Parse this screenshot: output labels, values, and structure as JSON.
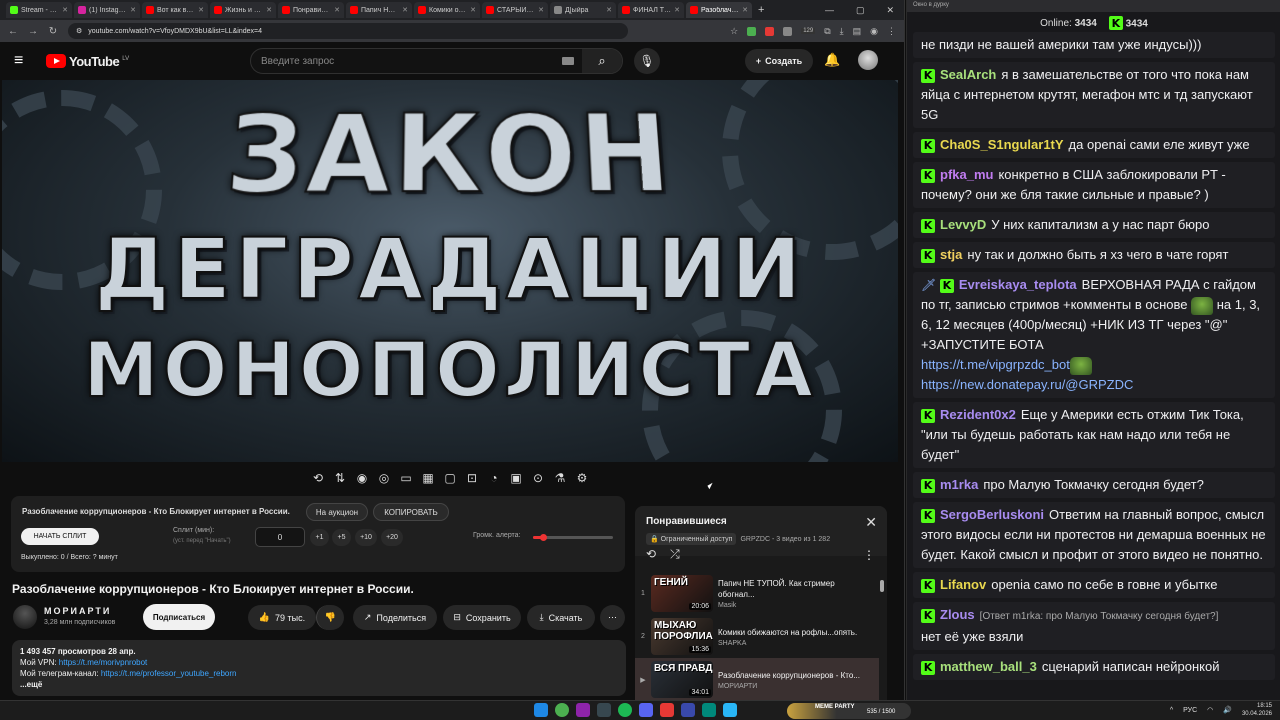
{
  "browser": {
    "tabs": [
      {
        "label": "Stream - Kick",
        "color": "#53fc18",
        "active": false
      },
      {
        "label": "(1) Instagram",
        "color": "#d6249f",
        "active": false
      },
      {
        "label": "Вот как в РФ",
        "color": "#ff0000",
        "active": false
      },
      {
        "label": "Жизнь и стр",
        "color": "#ff0000",
        "active": false
      },
      {
        "label": "Понравившиеся",
        "color": "#ff0000",
        "active": false
      },
      {
        "label": "Папич НЕ ТУП",
        "color": "#ff0000",
        "active": false
      },
      {
        "label": "Комики обиж",
        "color": "#ff0000",
        "active": false
      },
      {
        "label": "СТАРЫЙ БОГ",
        "color": "#ff0000",
        "active": false
      },
      {
        "label": "Д[ыйра",
        "color": "#888888",
        "active": false
      },
      {
        "label": "ФИНАЛ ТВИЧ",
        "color": "#ff0000",
        "active": false
      },
      {
        "label": "Разоблачени",
        "color": "#ff0000",
        "active": true
      }
    ],
    "url": "youtube.com/watch?v=VfoyDMDX9bU&list=LL&index=4",
    "ext_badge": "129"
  },
  "youtube": {
    "logo_text": "YouTube",
    "country": "LV",
    "search_placeholder": "Введите запрос",
    "create_label": "Создать"
  },
  "video": {
    "thumb_line1": "ЗАКОН",
    "thumb_line2": "ДЕГРАДАЦИИ",
    "thumb_line3": "МОНОПОЛИСТА"
  },
  "extension": {
    "title": "Разоблачение коррупционеров - Кто Блокирует интернет в России.",
    "auction_label": "На аукцион",
    "copy_label": "КОПИРОВАТЬ",
    "split_button": "НАЧАТЬ СПЛИТ",
    "split_label": "Сплит (мин):",
    "split_hint": "(уст. перед \"Начать\")",
    "split_value": "0",
    "inc": [
      "+1",
      "+5",
      "+10",
      "+20"
    ],
    "volume_label": "Громк. алерта:",
    "volume_level": 0.12,
    "status": "Выкуплено: 0 / Всего: ? минут"
  },
  "watch": {
    "title": "Разоблачение коррупционеров - Кто Блокирует интернет в России.",
    "channel": "МОРИАРТИ",
    "subs": "3,28 млн подписчиков",
    "subscribe": "Подписаться",
    "likes": "79 тыс.",
    "share": "Поделиться",
    "save": "Сохранить",
    "download": "Скачать",
    "views_line": "1 493 457 просмотров  28 апр.",
    "vpn_label": "Мой VPN: ",
    "vpn_link": "https://t.me/morivpnrobot",
    "tg_label": "Мой телеграм-канал: ",
    "tg_link": "https://t.me/professor_youtube_reborn",
    "more": "...ещё"
  },
  "playlist": {
    "title": "Понравившиеся",
    "access": "Ограниченный доступ",
    "meta": "GRPZDC - 3 видео из 1 282",
    "items": [
      {
        "n": "1",
        "title": "Папич НЕ ТУПОЙ. Как стример обогнал...",
        "channel": "Masik",
        "duration": "20:06",
        "thumb": "ГЕНИЙ",
        "bg": "#5a2a20"
      },
      {
        "n": "2",
        "title": "Комики обижаются на рофлы...опять.",
        "channel": "SHAPKA",
        "duration": "15:36",
        "thumb": "МЫХАЮ ПОРОФЛИА",
        "bg": "#4a3a30"
      },
      {
        "n": "▶",
        "title": "Разоблачение коррупционеров - Кто...",
        "channel": "МОРИАРТИ",
        "duration": "34:01",
        "thumb": "ВСЯ ПРАВД",
        "bg": "#2a3038"
      }
    ]
  },
  "chat": {
    "window_title": "Окно в дурку",
    "online_label": "Online:",
    "online": "3434",
    "viewers": "3434",
    "messages": [
      {
        "user": "",
        "color": "#efeff1",
        "text": "не пизди не вашей америки там уже индусы)))",
        "badge": false
      },
      {
        "user": "SealArch",
        "color": "#a8e07c",
        "text": "я в замешательстве от того что пока нам яйца с интернетом крутят, мегафон мтс и тд запускают 5G",
        "badge": true
      },
      {
        "user": "Cha0S_S1ngular1tY",
        "color": "#e9d84f",
        "text": "да openai сами еле живут уже",
        "badge": true
      },
      {
        "user": "pfka_mu",
        "color": "#c07cf0",
        "text": "конкретно в США заблокировали PT - почему? они же бля такие сильные и правые? )",
        "badge": true
      },
      {
        "user": "LevvyD",
        "color": "#a8e07c",
        "text": "У них капитализм а у нас парт бюро",
        "badge": true
      },
      {
        "user": "stja",
        "color": "#f0d060",
        "text": "ну так и должно быть я хз чего в чате горят",
        "badge": true
      },
      {
        "user": "Evreiskaya_teplota",
        "color": "#a88cf0",
        "text": "ВЕРХОВНАЯ РАДА с гайдом по тг, записью стримов +комменты в основе",
        "text2": "на 1, 3, 6, 12 месяцев (400р/месяц) +НИК ИЗ ТГ через \"@\" +ЗАПУСТИТЕ БОТА",
        "link1": "https://t.me/vipgrpzdc_bot",
        "link2": "https://new.donatepay.ru/@GRPZDC",
        "badge": true
      },
      {
        "user": "Rezident0x2",
        "color": "#a88cf0",
        "text": "Еще у Америки есть отжим Тик Тока, \"или ты будешь работать как нам надо или тебя не будет\"",
        "badge": true
      },
      {
        "user": "m1rka",
        "color": "#a88cf0",
        "text": "про Малую Токмачку сегодня будет?",
        "badge": true
      },
      {
        "user": "SergoBerluskoni",
        "color": "#a88cf0",
        "text": "Ответим на главный вопрос, смысл этого видосы если ни протестов ни демарша военных не будет. Какой смысл и профит от этого видео не понятно.",
        "badge": true
      },
      {
        "user": "Lifanov",
        "color": "#e9d84f",
        "text": "openia само по себе в говне и убытке",
        "badge": true
      },
      {
        "user": "Zlous",
        "color": "#a88cf0",
        "reply": "[Ответ m1rka: про Малую Токмачку сегодня будет?]",
        "text": "нет её уже взяли",
        "badge": true
      },
      {
        "user": "matthew_ball_3",
        "color": "#a8e07c",
        "text": "сценарий написан нейронкой",
        "badge": true
      }
    ]
  },
  "taskbar": {
    "widget": "535 / 1500",
    "widget_brand": "MEME PARTY",
    "lang": "РУС",
    "time": "18:15",
    "date": "30.04.2026"
  }
}
